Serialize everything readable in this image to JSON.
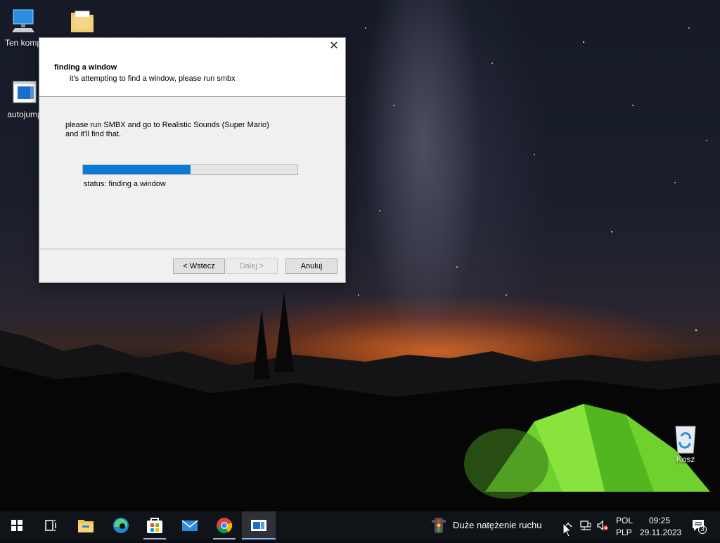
{
  "desktop": {
    "icons": [
      {
        "label": "Ten komp",
        "icon": "computer-icon"
      },
      {
        "label": "",
        "icon": "folder-icon"
      },
      {
        "label": "autojump",
        "icon": "app-window-icon"
      },
      {
        "label": "Kosz",
        "icon": "recycle-bin-icon"
      }
    ]
  },
  "dialog": {
    "close_glyph": "✕",
    "heading": "finding a window",
    "subheading": "it's attempting to find a window, please run smbx",
    "body_line1": "please run SMBX and go to Realistic Sounds (Super Mario)",
    "body_line2": "and it'll find that.",
    "progress_fraction": 0.5,
    "status": "status: finding a window",
    "buttons": {
      "back": "< Wstecz",
      "next": "Dalej >",
      "cancel": "Anuluj"
    }
  },
  "taskbar": {
    "apps": [
      "start-icon",
      "task-view-icon",
      "file-explorer-icon",
      "edge-icon",
      "store-icon",
      "mail-icon",
      "chrome-icon",
      "app-window-icon"
    ],
    "traffic_text": "Duże natężenie ruchu",
    "lang_top": "POL",
    "lang_bottom": "PLP",
    "time": "09:25",
    "date": "29.11.2023",
    "notification_count": "3"
  },
  "colors": {
    "accent": "#0078d7",
    "progress": "#0a7ad6",
    "taskbar": "#101318"
  }
}
